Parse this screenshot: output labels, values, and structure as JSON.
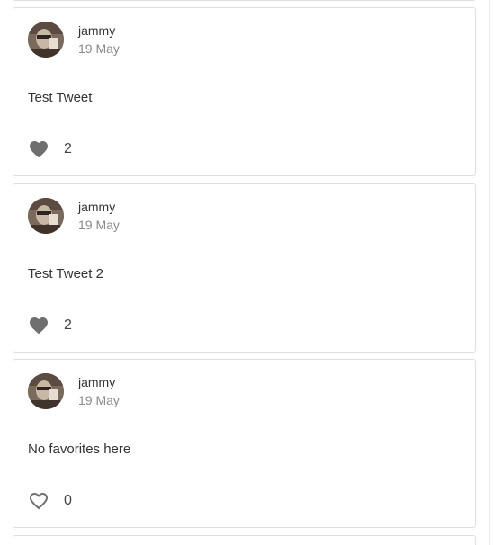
{
  "tweets": [
    {
      "username": "jammy",
      "date": "19 May",
      "text": "Test Tweet",
      "favorite_count": "2",
      "favorited": true,
      "heart_icon": "heart-filled-icon"
    },
    {
      "username": "jammy",
      "date": "19 May",
      "text": "Test Tweet 2",
      "favorite_count": "2",
      "favorited": true,
      "heart_icon": "heart-filled-icon"
    },
    {
      "username": "jammy",
      "date": "19 May",
      "text": "No favorites here",
      "favorite_count": "0",
      "favorited": false,
      "heart_icon": "heart-outline-icon"
    }
  ],
  "colors": {
    "heart": "#6f6f6f",
    "card_border": "#dedede",
    "date_text": "#8a8a8a"
  }
}
